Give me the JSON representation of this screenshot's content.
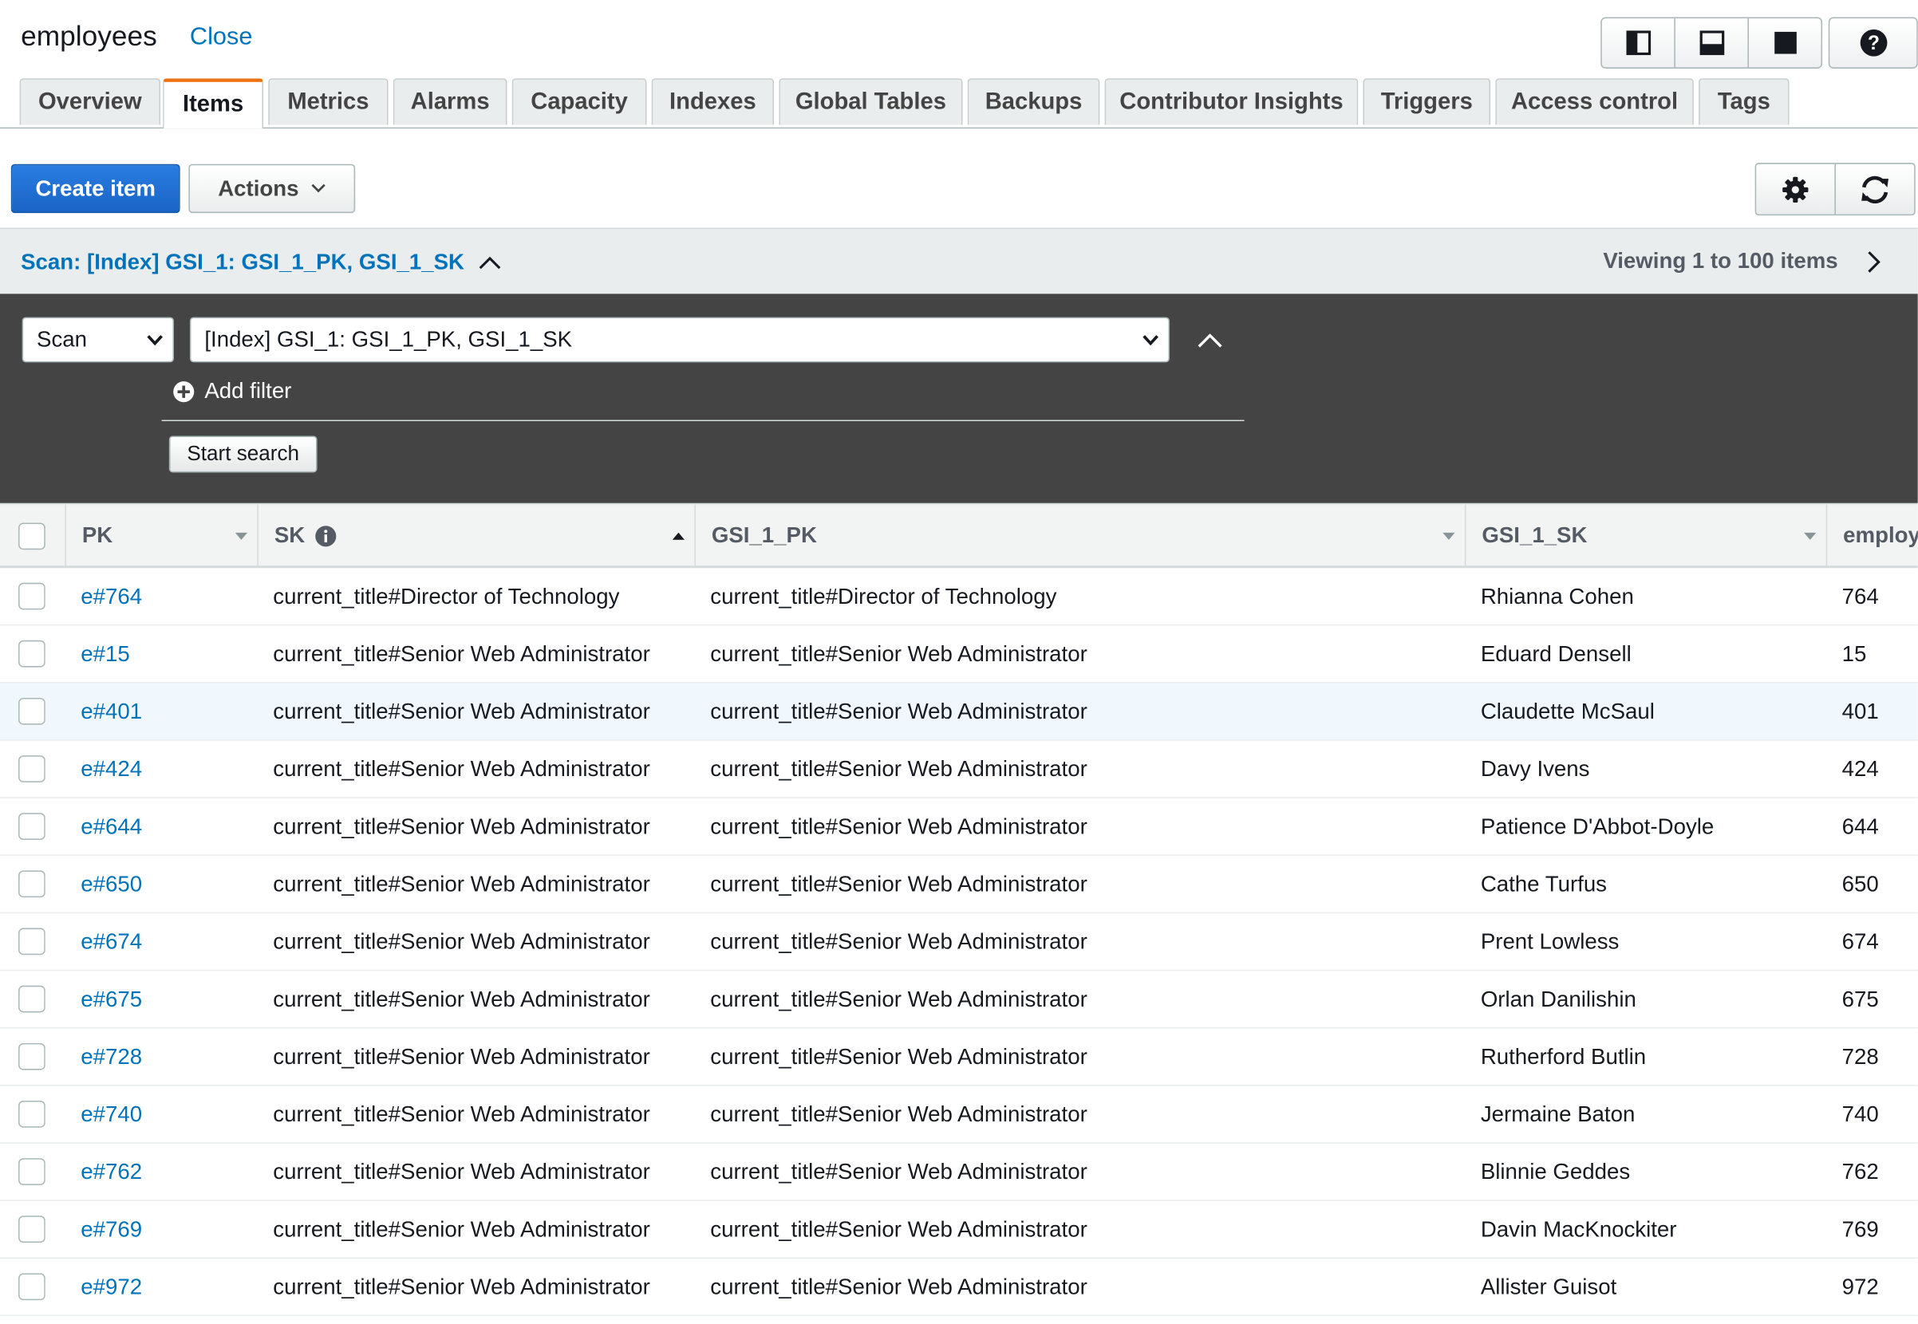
{
  "header": {
    "table_name": "employees",
    "close_label": "Close",
    "view_buttons": [
      {
        "icon": "split-vertical-icon"
      },
      {
        "icon": "split-horizontal-icon"
      },
      {
        "icon": "full-screen-icon"
      }
    ],
    "help_icon": "help-icon"
  },
  "tabs": [
    {
      "label": "Overview",
      "active": false
    },
    {
      "label": "Items",
      "active": true
    },
    {
      "label": "Metrics",
      "active": false
    },
    {
      "label": "Alarms",
      "active": false
    },
    {
      "label": "Capacity",
      "active": false
    },
    {
      "label": "Indexes",
      "active": false
    },
    {
      "label": "Global Tables",
      "active": false
    },
    {
      "label": "Backups",
      "active": false
    },
    {
      "label": "Contributor Insights",
      "active": false
    },
    {
      "label": "Triggers",
      "active": false
    },
    {
      "label": "Access control",
      "active": false
    },
    {
      "label": "Tags",
      "active": false
    }
  ],
  "toolbar": {
    "create_label": "Create item",
    "actions_label": "Actions",
    "settings_icon": "gear-icon",
    "refresh_icon": "refresh-icon"
  },
  "scan": {
    "title": "Scan: [Index] GSI_1: GSI_1_PK, GSI_1_SK",
    "viewing": "Viewing 1 to 100 items",
    "operation": "Scan",
    "index": "[Index] GSI_1: GSI_1_PK, GSI_1_SK",
    "add_filter_label": "Add filter",
    "start_search_label": "Start search"
  },
  "table": {
    "columns": [
      "PK",
      "SK",
      "GSI_1_PK",
      "GSI_1_SK",
      "employ"
    ],
    "rows": [
      {
        "pk": "e#764",
        "sk": "current_title#Director of Technology",
        "gsi_pk": "current_title#Director of Technology",
        "gsi_sk": "Rhianna Cohen",
        "emp": "764"
      },
      {
        "pk": "e#15",
        "sk": "current_title#Senior Web Administrator",
        "gsi_pk": "current_title#Senior Web Administrator",
        "gsi_sk": "Eduard Densell",
        "emp": "15"
      },
      {
        "pk": "e#401",
        "sk": "current_title#Senior Web Administrator",
        "gsi_pk": "current_title#Senior Web Administrator",
        "gsi_sk": "Claudette McSaul",
        "emp": "401"
      },
      {
        "pk": "e#424",
        "sk": "current_title#Senior Web Administrator",
        "gsi_pk": "current_title#Senior Web Administrator",
        "gsi_sk": "Davy Ivens",
        "emp": "424"
      },
      {
        "pk": "e#644",
        "sk": "current_title#Senior Web Administrator",
        "gsi_pk": "current_title#Senior Web Administrator",
        "gsi_sk": "Patience D'Abbot-Doyle",
        "emp": "644"
      },
      {
        "pk": "e#650",
        "sk": "current_title#Senior Web Administrator",
        "gsi_pk": "current_title#Senior Web Administrator",
        "gsi_sk": "Cathe Turfus",
        "emp": "650"
      },
      {
        "pk": "e#674",
        "sk": "current_title#Senior Web Administrator",
        "gsi_pk": "current_title#Senior Web Administrator",
        "gsi_sk": "Prent Lowless",
        "emp": "674"
      },
      {
        "pk": "e#675",
        "sk": "current_title#Senior Web Administrator",
        "gsi_pk": "current_title#Senior Web Administrator",
        "gsi_sk": "Orlan Danilishin",
        "emp": "675"
      },
      {
        "pk": "e#728",
        "sk": "current_title#Senior Web Administrator",
        "gsi_pk": "current_title#Senior Web Administrator",
        "gsi_sk": "Rutherford Butlin",
        "emp": "728"
      },
      {
        "pk": "e#740",
        "sk": "current_title#Senior Web Administrator",
        "gsi_pk": "current_title#Senior Web Administrator",
        "gsi_sk": "Jermaine Baton",
        "emp": "740"
      },
      {
        "pk": "e#762",
        "sk": "current_title#Senior Web Administrator",
        "gsi_pk": "current_title#Senior Web Administrator",
        "gsi_sk": "Blinnie Geddes",
        "emp": "762"
      },
      {
        "pk": "e#769",
        "sk": "current_title#Senior Web Administrator",
        "gsi_pk": "current_title#Senior Web Administrator",
        "gsi_sk": "Davin MacKnockiter",
        "emp": "769"
      },
      {
        "pk": "e#972",
        "sk": "current_title#Senior Web Administrator",
        "gsi_pk": "current_title#Senior Web Administrator",
        "gsi_sk": "Allister Guisot",
        "emp": "972"
      }
    ]
  },
  "colors": {
    "link": "#0073bb",
    "primary": "#1e6fd9",
    "active_tab_accent": "#ec7211",
    "filter_panel": "#444444",
    "highlight_row": "#f1f8fd"
  }
}
